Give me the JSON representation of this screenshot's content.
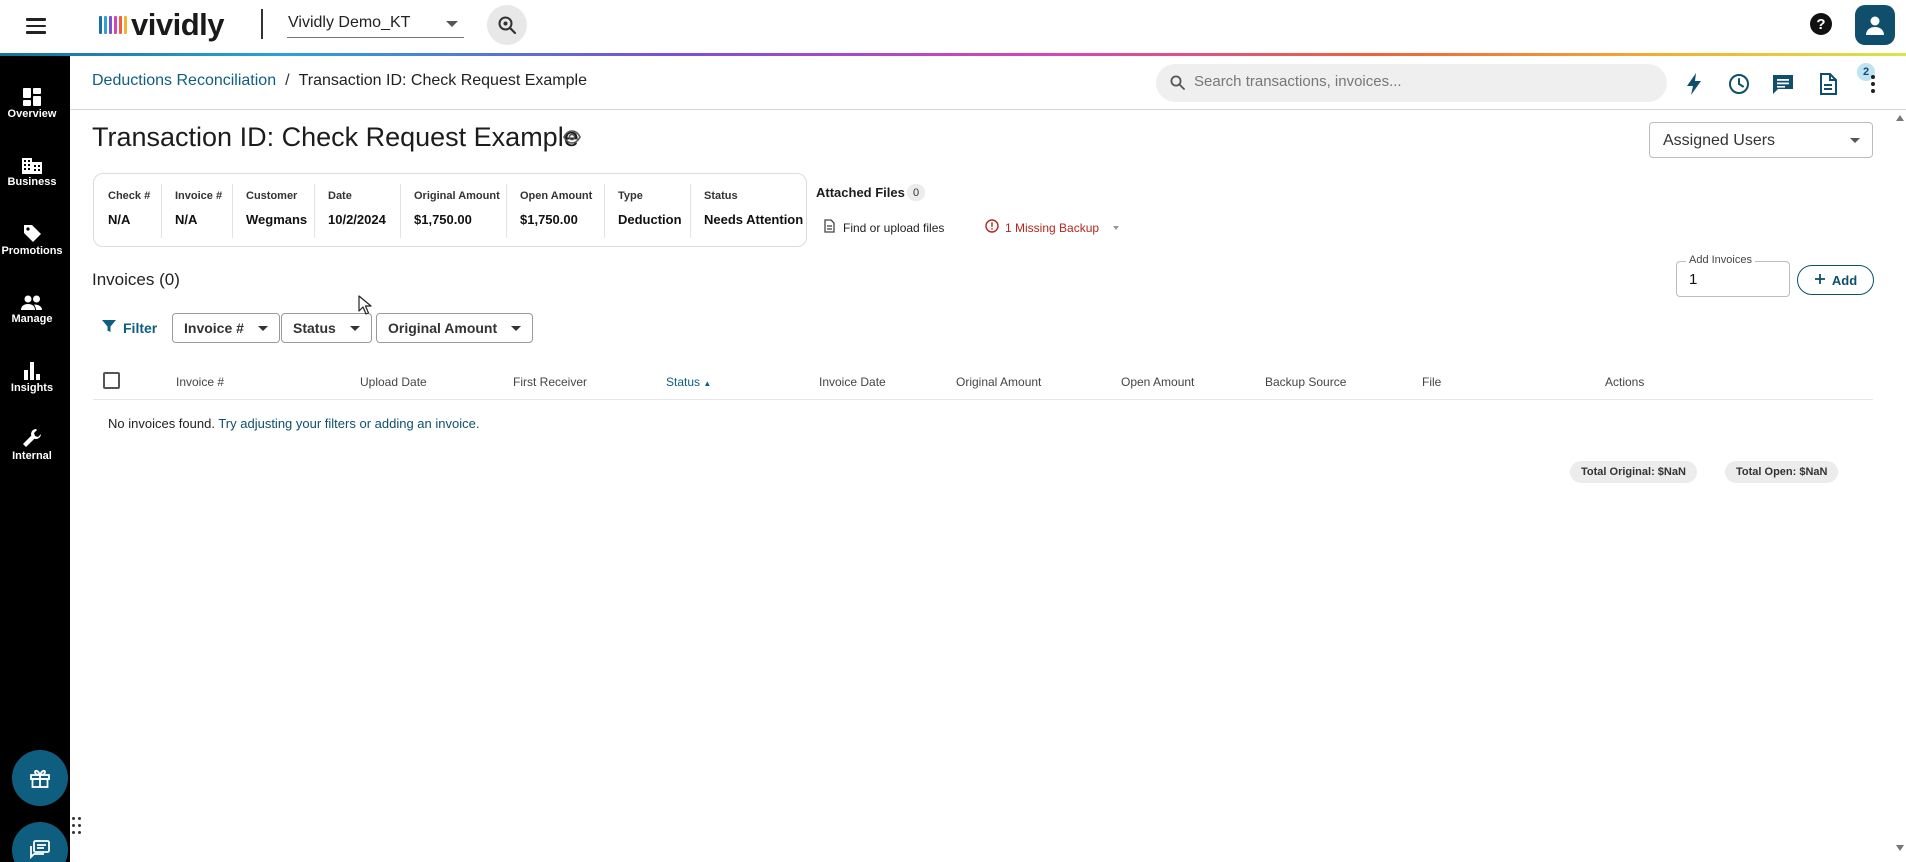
{
  "topbar": {
    "brand": "vividly",
    "logo_colors": [
      "#1b6ea0",
      "#2aa3d6",
      "#7b4fd8",
      "#d645b8",
      "#f0603c",
      "#f2b232"
    ],
    "org_selector": {
      "value": "Vividly Demo_KT",
      "icon": "chevron-down-icon"
    },
    "icons": [
      "menu-icon",
      "location-search-icon",
      "help-icon",
      "user-icon"
    ]
  },
  "nav": {
    "items": [
      {
        "label": "Overview",
        "icon": "dashboard-icon"
      },
      {
        "label": "Business",
        "icon": "building-icon"
      },
      {
        "label": "Promotions",
        "icon": "tag-icon"
      },
      {
        "label": "Manage",
        "icon": "people-icon"
      },
      {
        "label": "Insights",
        "icon": "bar-chart-icon"
      },
      {
        "label": "Internal",
        "icon": "wrench-icon"
      }
    ],
    "bottom_icons": [
      "gift-icon",
      "chat-icon"
    ]
  },
  "breadcrumb": {
    "parent": "Deductions Reconciliation",
    "separator": "/",
    "current": "Transaction ID: Check Request Example"
  },
  "search": {
    "placeholder": "Search transactions, invoices..."
  },
  "toolbar": {
    "icons": [
      "flash-icon",
      "history-icon",
      "comments-icon",
      "document-icon",
      "more-vert-icon"
    ],
    "comments_badge": "2"
  },
  "page": {
    "title": "Transaction ID: Check Request Example",
    "assigned_users": "Assigned Users"
  },
  "summary": [
    {
      "label": "Check #",
      "value": "N/A"
    },
    {
      "label": "Invoice #",
      "value": "N/A"
    },
    {
      "label": "Customer",
      "value": "Wegmans"
    },
    {
      "label": "Date",
      "value": "10/2/2024"
    },
    {
      "label": "Original Amount",
      "value": "$1,750.00"
    },
    {
      "label": "Open Amount",
      "value": "$1,750.00"
    },
    {
      "label": "Type",
      "value": "Deduction"
    },
    {
      "label": "Status",
      "value": "Needs Attention"
    }
  ],
  "attached": {
    "title": "Attached Files",
    "count": "0",
    "find_label": "Find or upload files",
    "missing_label": "1 Missing Backup"
  },
  "invoices": {
    "title": "Invoices (0)",
    "add_legend": "Add Invoices",
    "add_value": "1",
    "add_button": "Add"
  },
  "filters": {
    "label": "Filter",
    "chips": [
      "Invoice #",
      "Status",
      "Original Amount"
    ]
  },
  "table": {
    "columns": [
      "Invoice #",
      "Upload Date",
      "First Receiver",
      "Status",
      "Invoice Date",
      "Original Amount",
      "Open Amount",
      "Backup Source",
      "File",
      "Actions"
    ],
    "sort_column": "Status",
    "sort_direction": "ascending",
    "empty_prefix": "No invoices found.",
    "empty_hint": "Try adjusting your filters or adding an invoice."
  },
  "totals": {
    "original": "Total Original: $NaN",
    "open": "Total Open: $NaN"
  },
  "colors": {
    "accent": "#0f5e80",
    "nav_bg": "#000000",
    "fab": "#0f5e80",
    "warning": "#b3261e"
  }
}
